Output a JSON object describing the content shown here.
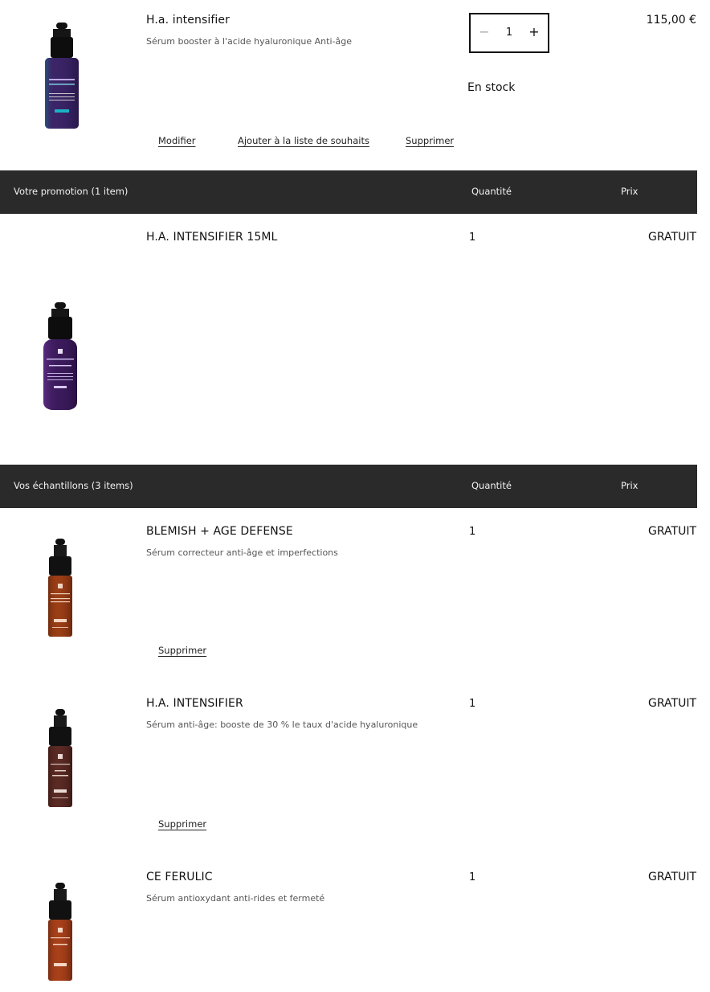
{
  "cart_item": {
    "name": "H.a. intensifier",
    "description": "Sérum booster à l'acide hyaluronique Anti-âge",
    "quantity": "1",
    "stock": "En stock",
    "price": "115,00 €",
    "actions": {
      "modify": "Modifier",
      "wishlist": "Ajouter à la liste de souhaits",
      "remove": "Supprimer"
    }
  },
  "promotion": {
    "header": {
      "title": "Votre promotion (1 item)",
      "quantity": "Quantité",
      "price": "Prix"
    },
    "item": {
      "name": "H.A. INTENSIFIER 15ML",
      "quantity": "1",
      "price": "GRATUIT"
    }
  },
  "samples": {
    "header": {
      "title": "Vos échantillons (3 items)",
      "quantity": "Quantité",
      "price": "Prix"
    },
    "items": [
      {
        "name": "BLEMISH + AGE DEFENSE",
        "description": "Sérum correcteur anti-âge et imperfections",
        "quantity": "1",
        "price": "GRATUIT",
        "remove": "Supprimer",
        "color": "#9a3e16"
      },
      {
        "name": "H.A. INTENSIFIER",
        "description": "Sérum anti-âge: booste de 30 % le taux d'acide hyaluronique",
        "quantity": "1",
        "price": "GRATUIT",
        "remove": "Supprimer",
        "color": "#5a2a24"
      },
      {
        "name": "CE FERULIC",
        "description": "Sérum antioxydant anti-rides et fermeté",
        "quantity": "1",
        "price": "GRATUIT",
        "color": "#a8401a"
      }
    ]
  }
}
